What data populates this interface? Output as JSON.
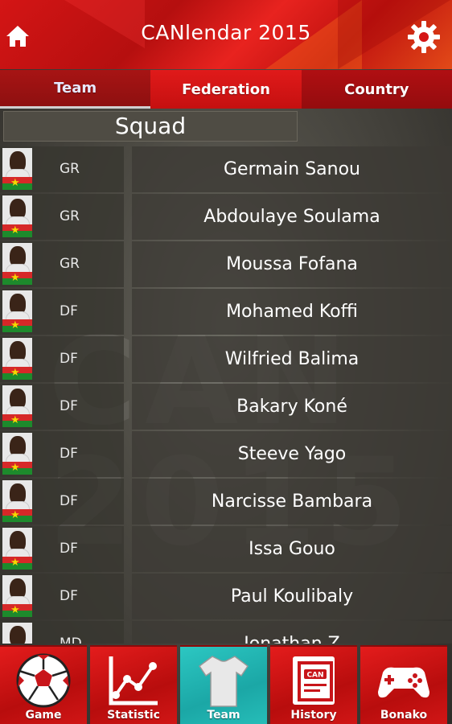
{
  "app": {
    "title": "CANlendar 2015"
  },
  "tabs": [
    {
      "label": "Team",
      "active": true
    },
    {
      "label": "Federation",
      "active": false
    },
    {
      "label": "Country",
      "active": false
    }
  ],
  "section": {
    "title": "Squad"
  },
  "players": [
    {
      "position": "GR",
      "name": "Germain Sanou"
    },
    {
      "position": "GR",
      "name": "Abdoulaye Soulama"
    },
    {
      "position": "GR",
      "name": "Moussa Fofana"
    },
    {
      "position": "DF",
      "name": "Mohamed Koffi"
    },
    {
      "position": "DF",
      "name": "Wilfried Balima"
    },
    {
      "position": "DF",
      "name": "Bakary Koné"
    },
    {
      "position": "DF",
      "name": "Steeve Yago"
    },
    {
      "position": "DF",
      "name": "Narcisse Bambara"
    },
    {
      "position": "DF",
      "name": "Issa Gouo"
    },
    {
      "position": "DF",
      "name": "Paul Koulibaly"
    },
    {
      "position": "MD",
      "name": "Jonathan Z"
    }
  ],
  "bottom_nav": [
    {
      "label": "Game",
      "icon": "soccer-ball-icon",
      "active": false
    },
    {
      "label": "Statistic",
      "icon": "line-chart-icon",
      "active": false
    },
    {
      "label": "Team",
      "icon": "jersey-icon",
      "active": true
    },
    {
      "label": "History",
      "icon": "can-book-icon",
      "active": false
    },
    {
      "label": "Bonako",
      "icon": "gamepad-icon",
      "active": false
    }
  ],
  "colors": {
    "accent_red": "#d41515",
    "active_teal": "#26bdb8",
    "flag_red": "#d62828",
    "flag_green": "#1d8a2c",
    "flag_star": "#f5d800"
  }
}
